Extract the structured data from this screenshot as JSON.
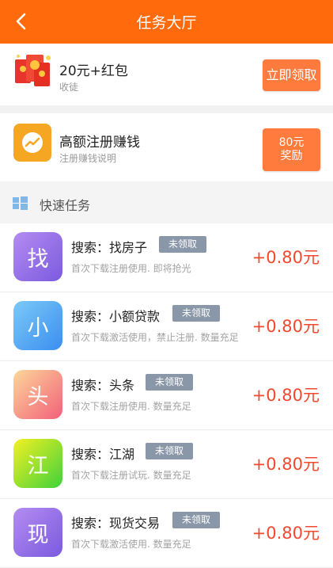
{
  "header": {
    "title": "任务大厅",
    "back_icon": "chevron-left-icon"
  },
  "promo": {
    "title": "20元+红包",
    "subtitle": "收徒",
    "button": "立即领取",
    "icon": "red-envelope-icon"
  },
  "featured": {
    "title": "高额注册赚钱",
    "subtitle": "注册赚钱说明",
    "button_line1": "80元",
    "button_line2": "奖励",
    "icon": "trend-chart-icon"
  },
  "section": {
    "title": "快速任务",
    "icon": "windows-grid-icon"
  },
  "tasks": [
    {
      "char": "找",
      "title": "搜索：找房子",
      "badge": "未领取",
      "desc": "首次下载注册使用. 即将抢光",
      "reward": "+0.80元"
    },
    {
      "char": "小",
      "title": "搜索：小额贷款",
      "badge": "未领取",
      "desc": "首次下载激活使用，禁止注册. 数量充足",
      "reward": "+0.80元"
    },
    {
      "char": "头",
      "title": "搜索：头条",
      "badge": "未领取",
      "desc": "首次下载注册使用. 数量充足",
      "reward": "+0.80元"
    },
    {
      "char": "江",
      "title": "搜索：江湖",
      "badge": "未领取",
      "desc": "首次下载注册试玩. 数量充足",
      "reward": "+0.80元"
    },
    {
      "char": "现",
      "title": "搜索：现货交易",
      "badge": "未领取",
      "desc": "首次下载激活使用. 数量充足",
      "reward": "+0.80元"
    }
  ]
}
